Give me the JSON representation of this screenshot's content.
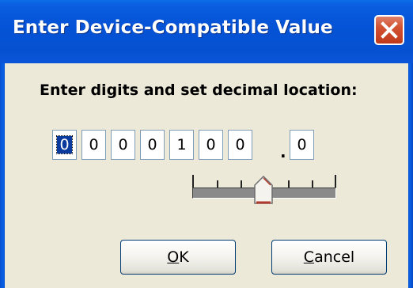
{
  "window": {
    "title": "Enter Device-Compatible Value"
  },
  "instruction": "Enter digits and set decimal location:",
  "digits": [
    "0",
    "0",
    "0",
    "0",
    "1",
    "0",
    "0",
    "0"
  ],
  "decimal_after_digit": 6,
  "selected_digit": 1,
  "slider": {
    "position": 4,
    "positions": 7
  },
  "buttons": {
    "ok": {
      "mnemonic": "O",
      "rest": "K"
    },
    "cancel": {
      "mnemonic": "C",
      "rest": "ancel"
    }
  },
  "icons": {
    "close": "close-icon",
    "thumb": "slider-thumb"
  },
  "colors": {
    "titlebar": "#0553d6",
    "client": "#ece9d8",
    "close_button": "#d25231",
    "selection": "#0a3a9e",
    "thumb_accent": "#b03a2e"
  }
}
